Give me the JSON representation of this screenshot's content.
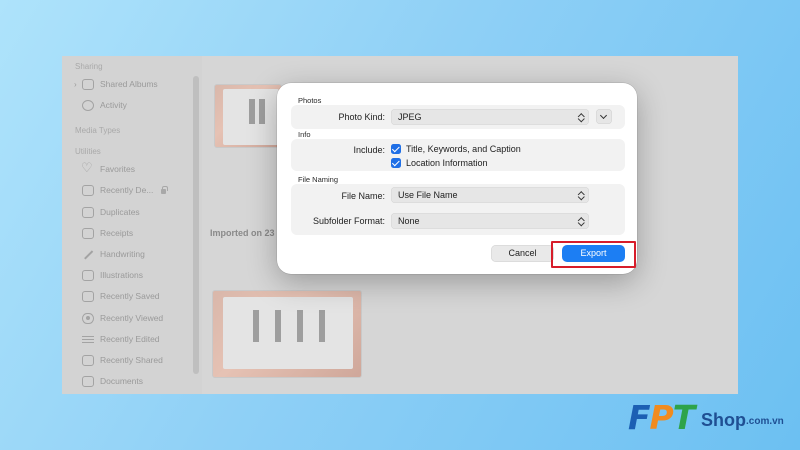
{
  "sidebar": {
    "sections": {
      "sharing": "Sharing",
      "media_types": "Media Types",
      "utilities": "Utilities"
    },
    "items": [
      {
        "label": "Shared Albums",
        "icon": "shared-albums-icon"
      },
      {
        "label": "Activity",
        "icon": "activity-icon"
      },
      {
        "label": "Favorites",
        "icon": "heart-icon"
      },
      {
        "label": "Recently De...",
        "icon": "trash-icon"
      },
      {
        "label": "Duplicates",
        "icon": "duplicates-icon"
      },
      {
        "label": "Receipts",
        "icon": "receipt-icon"
      },
      {
        "label": "Handwriting",
        "icon": "pen-icon"
      },
      {
        "label": "Illustrations",
        "icon": "illustration-icon"
      },
      {
        "label": "Recently Saved",
        "icon": "download-icon"
      },
      {
        "label": "Recently Viewed",
        "icon": "eye-icon"
      },
      {
        "label": "Recently Edited",
        "icon": "sliders-icon"
      },
      {
        "label": "Recently Shared",
        "icon": "share-icon"
      },
      {
        "label": "Documents",
        "icon": "document-icon"
      }
    ]
  },
  "content": {
    "imported_label": "Imported on 23 ..."
  },
  "dialog": {
    "photos_group": "Photos",
    "photo_kind_label": "Photo Kind:",
    "photo_kind_value": "JPEG",
    "info_group": "Info",
    "include_label": "Include:",
    "include_options": [
      {
        "label": "Title, Keywords, and Caption",
        "checked": true
      },
      {
        "label": "Location Information",
        "checked": true
      }
    ],
    "file_naming_group": "File Naming",
    "file_name_label": "File Name:",
    "file_name_value": "Use File Name",
    "subfolder_label": "Subfolder Format:",
    "subfolder_value": "None",
    "cancel_label": "Cancel",
    "export_label": "Export"
  },
  "logo": {
    "f": "F",
    "p": "P",
    "t": "T",
    "shop": "Shop",
    "domain": ".com.vn"
  },
  "colors": {
    "accent": "#1c7ef3",
    "highlight": "#d71d2a",
    "background": "#8fd0f6"
  }
}
